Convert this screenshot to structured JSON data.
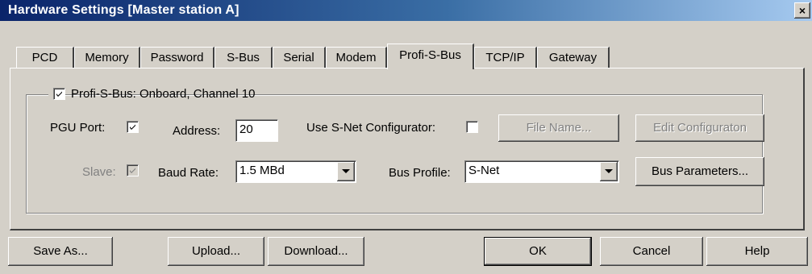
{
  "window": {
    "title": "Hardware Settings [Master station A]",
    "close_glyph": "×"
  },
  "tabs": [
    {
      "label": "PCD"
    },
    {
      "label": "Memory"
    },
    {
      "label": "Password"
    },
    {
      "label": "S-Bus"
    },
    {
      "label": "Serial"
    },
    {
      "label": "Modem"
    },
    {
      "label": "Profi-S-Bus",
      "active": true
    },
    {
      "label": "TCP/IP"
    },
    {
      "label": "Gateway"
    }
  ],
  "group": {
    "label": "Profi-S-Bus: Onboard, Channel 10",
    "checked": true
  },
  "form": {
    "pgu_port_label": "PGU Port:",
    "pgu_port_checked": true,
    "address_label": "Address:",
    "address_value": "20",
    "use_snet_label": "Use S-Net Configurator:",
    "use_snet_checked": false,
    "file_name_button": "File Name...",
    "edit_config_button": "Edit Configuraton",
    "slave_label": "Slave:",
    "slave_checked": true,
    "baud_rate_label": "Baud Rate:",
    "baud_rate_value": "1.5 MBd",
    "bus_profile_label": "Bus Profile:",
    "bus_profile_value": "S-Net",
    "bus_parameters_button": "Bus Parameters..."
  },
  "footer": {
    "save_as": "Save As...",
    "upload": "Upload...",
    "download": "Download...",
    "ok": "OK",
    "cancel": "Cancel",
    "help": "Help"
  },
  "icons": {
    "check": "check-icon",
    "dropdown": "chevron-down-icon",
    "close": "close-icon"
  },
  "colors": {
    "face": "#d4d0c8",
    "title_start": "#0a246a",
    "title_end": "#a6caf0",
    "disabled_text": "#808080"
  }
}
